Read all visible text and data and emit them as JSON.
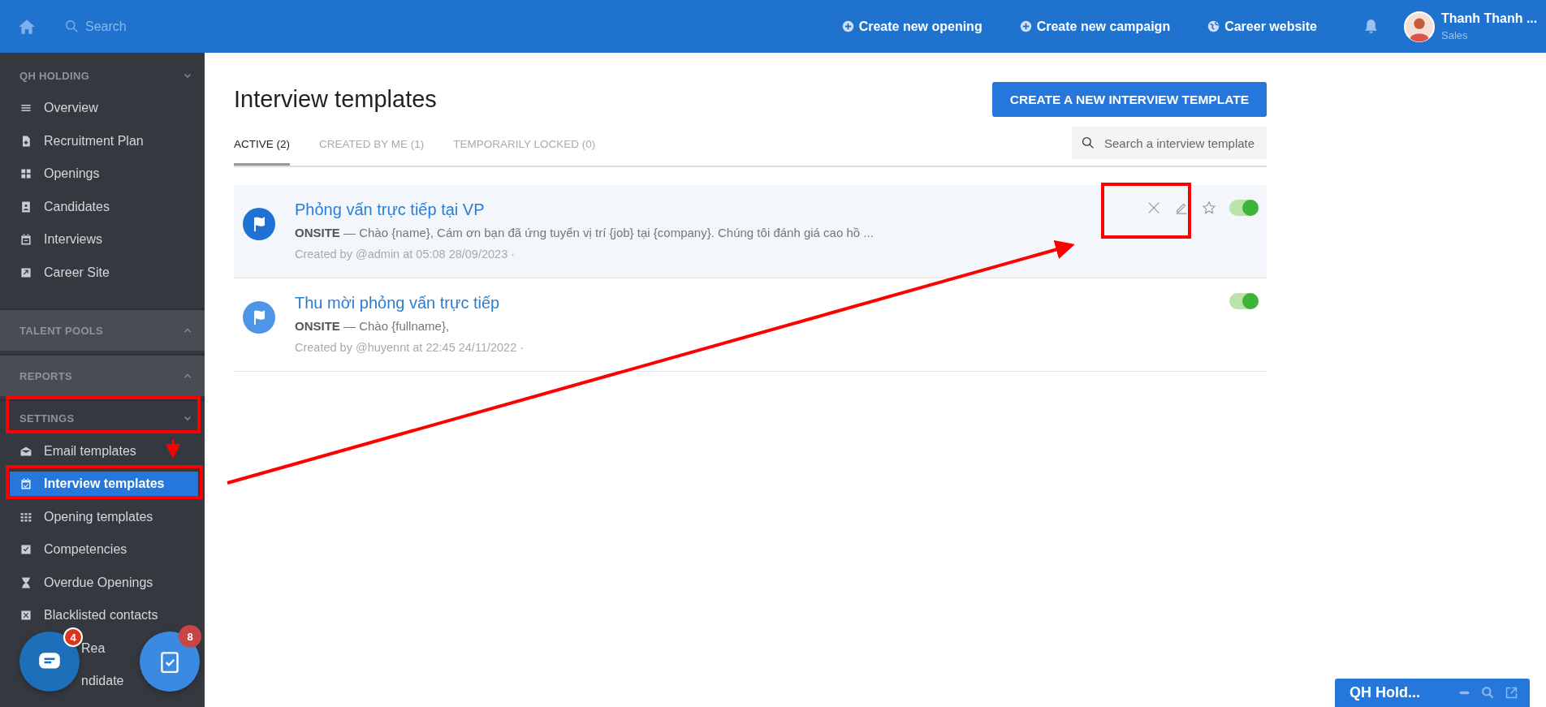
{
  "topbar": {
    "search_placeholder": "Search",
    "actions": [
      {
        "kind": "plus",
        "label": "Create new opening"
      },
      {
        "kind": "plus",
        "label": "Create new campaign"
      },
      {
        "kind": "globe",
        "label": "Career website"
      }
    ],
    "user": {
      "name": "Thanh Thanh ...",
      "role": "Sales"
    }
  },
  "sidebar": {
    "sections": [
      {
        "title": "QH HOLDING",
        "expanded": true,
        "items": [
          {
            "label": "Overview",
            "selected": false
          },
          {
            "label": "Recruitment Plan",
            "selected": false
          },
          {
            "label": "Openings",
            "selected": false
          },
          {
            "label": "Candidates",
            "selected": false
          },
          {
            "label": "Interviews",
            "selected": false
          },
          {
            "label": "Career Site",
            "selected": false
          }
        ]
      },
      {
        "title": "TALENT POOLS",
        "expanded": false
      },
      {
        "title": "REPORTS",
        "expanded": false
      },
      {
        "title": "SETTINGS",
        "expanded": true,
        "items": [
          {
            "label": "Email templates",
            "selected": false
          },
          {
            "label": "Interview templates",
            "selected": true
          },
          {
            "label": "Opening templates",
            "selected": false
          },
          {
            "label": "Competencies",
            "selected": false
          },
          {
            "label": "Overdue Openings",
            "selected": false
          },
          {
            "label": "Blacklisted contacts",
            "selected": false
          },
          {
            "label": "Rea",
            "selected": false
          },
          {
            "label": "ndidate",
            "selected": false
          }
        ]
      }
    ]
  },
  "page": {
    "title": "Interview templates",
    "create_button": "CREATE A NEW INTERVIEW TEMPLATE",
    "tabs": [
      {
        "label": "ACTIVE (2)",
        "selected": true
      },
      {
        "label": "CREATED BY ME (1)",
        "selected": false
      },
      {
        "label": "TEMPORARILY LOCKED (0)",
        "selected": false
      }
    ],
    "search_placeholder": "Search a interview template",
    "templates": [
      {
        "name": "Phỏng vấn trực tiếp tại VP",
        "type": "ONSITE",
        "preview": " — Chào {name}, Cám ơn bạn đã ứng tuyển vị trí {job} tại {company}. Chúng tôi đánh giá cao hồ ...",
        "created": "Created by @admin at 05:08 28/09/2023 ·",
        "hovered": true,
        "on": true
      },
      {
        "name": "Thu mời phỏng vấn trực tiếp",
        "type": "ONSITE",
        "preview": " — Chào {fullname},",
        "created": "Created by @huyennt at 22:45 24/11/2022 ·",
        "hovered": false,
        "on": true
      }
    ]
  },
  "floating": [
    {
      "kind": "chat",
      "badge": "4"
    },
    {
      "kind": "tasks",
      "badge": "8"
    }
  ],
  "chat_bar": {
    "title": "QH Hold..."
  }
}
